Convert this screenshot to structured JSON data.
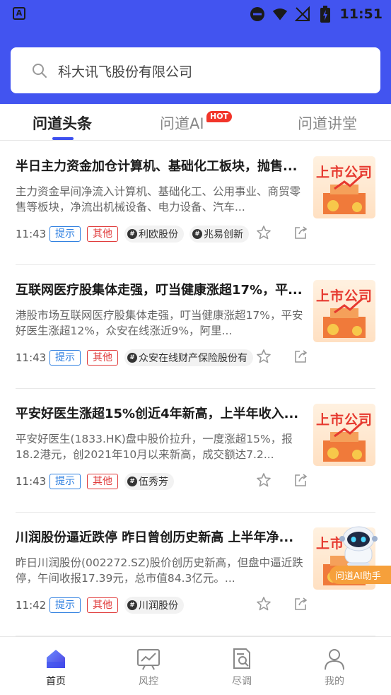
{
  "status_bar": {
    "time": "11:51",
    "left_icon": "A"
  },
  "search": {
    "placeholder": "科大讯飞股份有限公司"
  },
  "tabs": [
    {
      "label": "问道头条",
      "active": true
    },
    {
      "label": "问道AI",
      "badge": "HOT",
      "active": false
    },
    {
      "label": "问道讲堂",
      "active": false
    }
  ],
  "news": [
    {
      "title": "半日主力资金加仓计算机、基础化工板块，抛售...",
      "desc": "主力资金早间净流入计算机、基础化工、公用事业、商贸零售等板块，净流出机械设备、电力设备、汽车...",
      "time": "11:43",
      "tags": [
        "提示",
        "其他"
      ],
      "topics": [
        "利欧股份",
        "兆易创新"
      ],
      "thumb_text": "上市公司"
    },
    {
      "title": "互联网医疗股集体走强，叮当健康涨超17%，平...",
      "desc": "港股市场互联网医疗股集体走强，叮当健康涨超17%，平安好医生涨超12%，众安在线涨近9%，阿里...",
      "time": "11:43",
      "tags": [
        "提示",
        "其他"
      ],
      "topics": [
        "众安在线财产保险股份有"
      ],
      "thumb_text": "上市公司"
    },
    {
      "title": "平安好医生涨超15%创近4年新高，上半年收入...",
      "desc": "平安好医生(1833.HK)盘中股价拉升，一度涨超15%，报18.2港元，创2021年10月以来新高，成交额达7.2...",
      "time": "11:43",
      "tags": [
        "提示",
        "其他"
      ],
      "topics": [
        "伍秀芳"
      ],
      "thumb_text": "上市公司"
    },
    {
      "title": "川润股份逼近跌停 昨日曾创历史新高 上半年净...",
      "desc": "昨日川润股份(002272.SZ)股价创历史新高，但盘中逼近跌停，午间收报17.39元，总市值84.3亿元。...",
      "time": "11:42",
      "tags": [
        "提示",
        "其他"
      ],
      "topics": [
        "川润股份"
      ],
      "thumb_text": "上市"
    }
  ],
  "ai_assistant": {
    "label": "问道AI助手"
  },
  "bottom_nav": [
    {
      "label": "首页",
      "icon": "home-icon",
      "active": true
    },
    {
      "label": "风控",
      "icon": "chart-board-icon",
      "active": false
    },
    {
      "label": "尽调",
      "icon": "document-search-icon",
      "active": false
    },
    {
      "label": "我的",
      "icon": "person-icon",
      "active": false
    }
  ],
  "colors": {
    "brand": "#4254f0",
    "accent_blue": "#3e50ef",
    "tag_blue": "#2e7fe0",
    "tag_red": "#e03a3a",
    "hot_red": "#f2352a",
    "ai_orange": "#f6a03b"
  }
}
